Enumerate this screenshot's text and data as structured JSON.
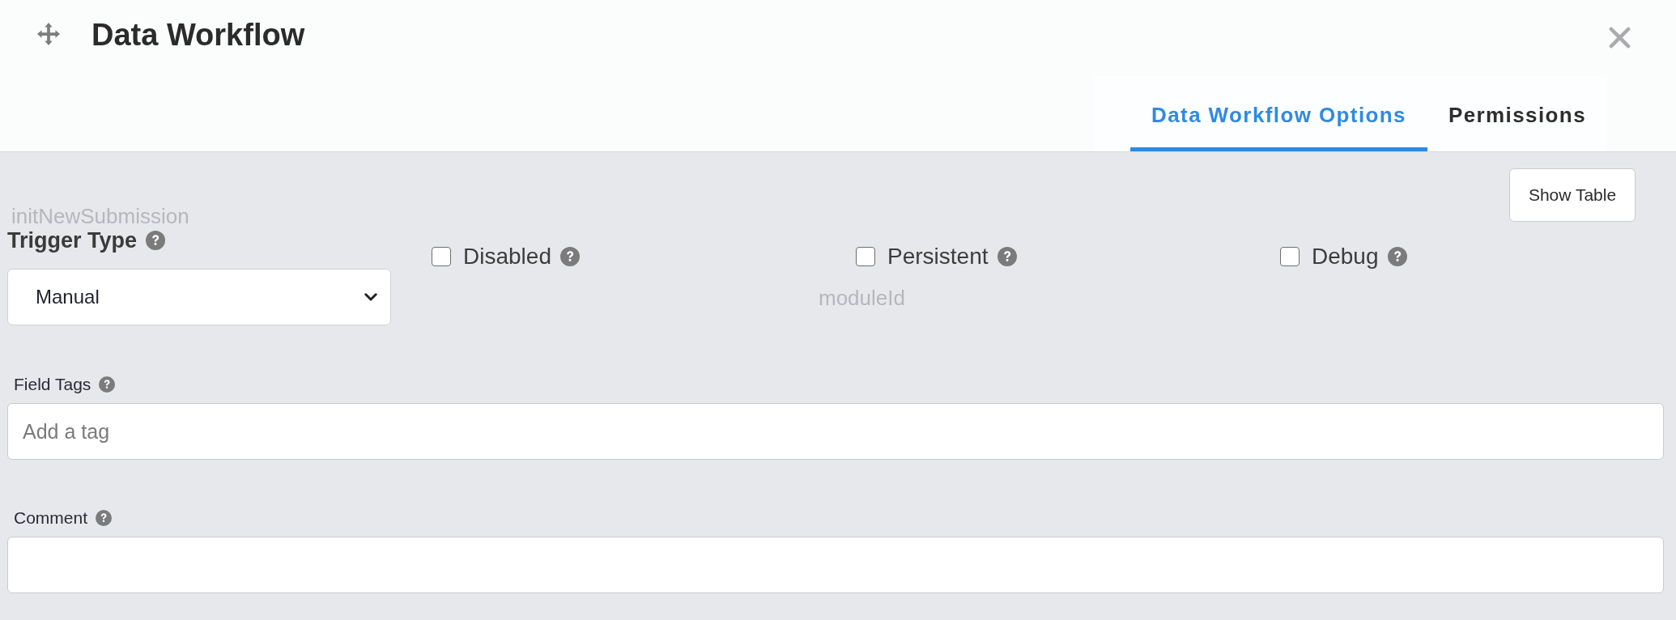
{
  "dialog": {
    "title": "Data Workflow"
  },
  "tabs": [
    {
      "label": "Data Workflow Options",
      "selected": true
    },
    {
      "label": "Permissions",
      "selected": false
    }
  ],
  "toolbar": {
    "button": "Show Table"
  },
  "background_texts": [
    "initNewSubmission",
    "moduleId"
  ],
  "trigger_type": {
    "label": "Trigger Type",
    "value": "Manual"
  },
  "options": [
    {
      "label": "Disabled",
      "checked": false
    },
    {
      "label": "Persistent",
      "checked": false
    },
    {
      "label": "Debug",
      "checked": false
    }
  ],
  "field_tags": {
    "label": "Field Tags",
    "placeholder": "Add a tag"
  },
  "comment": {
    "label": "Comment"
  }
}
